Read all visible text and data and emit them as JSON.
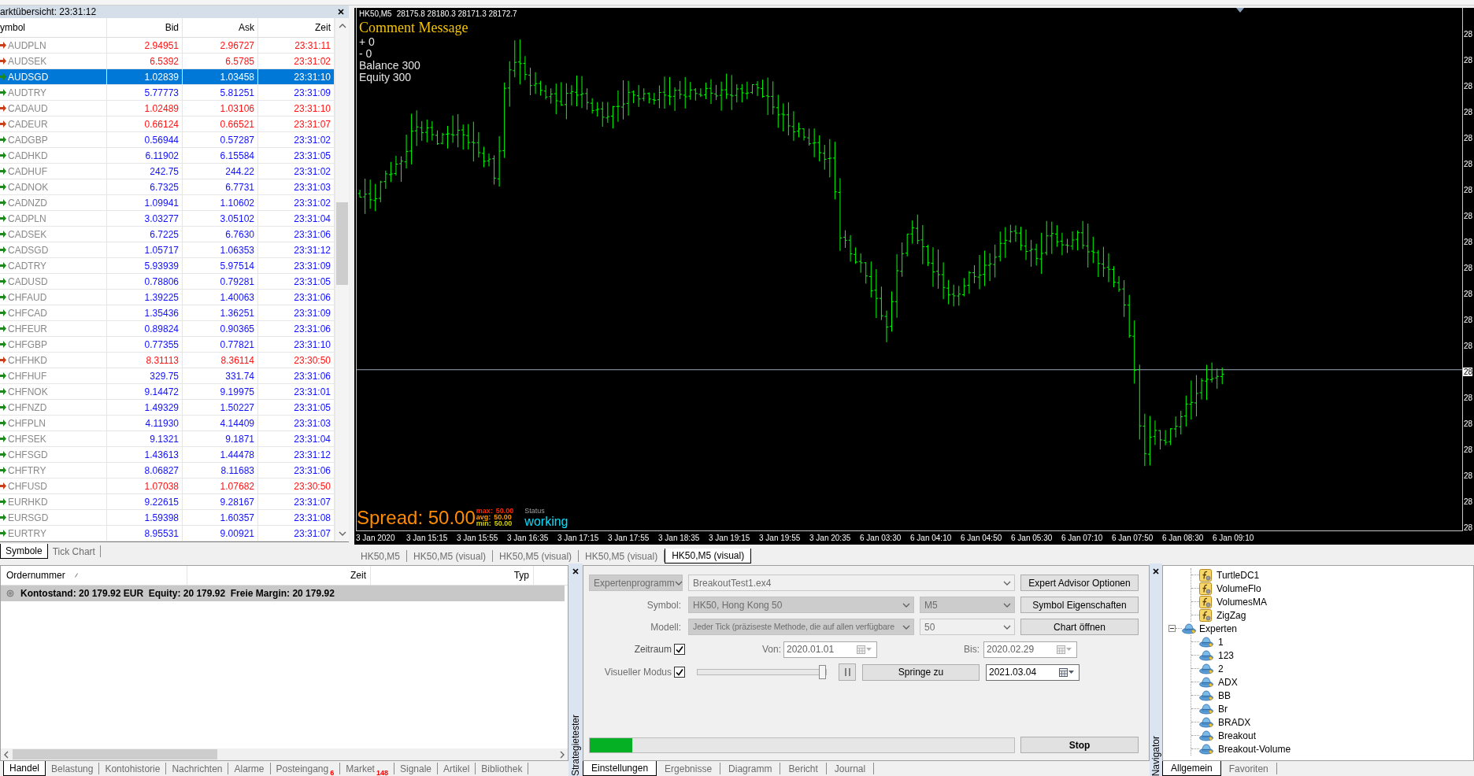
{
  "market_watch": {
    "title": "arktübersicht: 23:31:12",
    "columns": [
      "ymbol",
      "Bid",
      "Ask",
      "Zeit"
    ],
    "rows": [
      {
        "symbol": "AUDPLN",
        "bid": "2.94951",
        "ask": "2.96727",
        "time": "23:31:11",
        "rising": false,
        "selected": false
      },
      {
        "symbol": "AUDSEK",
        "bid": "6.5392",
        "ask": "6.5785",
        "time": "23:31:02",
        "rising": false,
        "selected": false
      },
      {
        "symbol": "AUDSGD",
        "bid": "1.02839",
        "ask": "1.03458",
        "time": "23:31:10",
        "rising": true,
        "selected": true
      },
      {
        "symbol": "AUDTRY",
        "bid": "5.77773",
        "ask": "5.81251",
        "time": "23:31:09",
        "rising": true,
        "selected": false
      },
      {
        "symbol": "CADAUD",
        "bid": "1.02489",
        "ask": "1.03106",
        "time": "23:31:10",
        "rising": false,
        "selected": false
      },
      {
        "symbol": "CADEUR",
        "bid": "0.66124",
        "ask": "0.66521",
        "time": "23:31:07",
        "rising": false,
        "selected": false
      },
      {
        "symbol": "CADGBP",
        "bid": "0.56944",
        "ask": "0.57287",
        "time": "23:31:02",
        "rising": true,
        "selected": false
      },
      {
        "symbol": "CADHKD",
        "bid": "6.11902",
        "ask": "6.15584",
        "time": "23:31:05",
        "rising": true,
        "selected": false
      },
      {
        "symbol": "CADHUF",
        "bid": "242.75",
        "ask": "244.22",
        "time": "23:31:02",
        "rising": true,
        "selected": false
      },
      {
        "symbol": "CADNOK",
        "bid": "6.7325",
        "ask": "6.7731",
        "time": "23:31:03",
        "rising": true,
        "selected": false
      },
      {
        "symbol": "CADNZD",
        "bid": "1.09941",
        "ask": "1.10602",
        "time": "23:31:02",
        "rising": true,
        "selected": false
      },
      {
        "symbol": "CADPLN",
        "bid": "3.03277",
        "ask": "3.05102",
        "time": "23:31:04",
        "rising": true,
        "selected": false
      },
      {
        "symbol": "CADSEK",
        "bid": "6.7225",
        "ask": "6.7630",
        "time": "23:31:06",
        "rising": true,
        "selected": false
      },
      {
        "symbol": "CADSGD",
        "bid": "1.05717",
        "ask": "1.06353",
        "time": "23:31:12",
        "rising": true,
        "selected": false
      },
      {
        "symbol": "CADTRY",
        "bid": "5.93939",
        "ask": "5.97514",
        "time": "23:31:09",
        "rising": true,
        "selected": false
      },
      {
        "symbol": "CADUSD",
        "bid": "0.78806",
        "ask": "0.79281",
        "time": "23:31:05",
        "rising": true,
        "selected": false
      },
      {
        "symbol": "CHFAUD",
        "bid": "1.39225",
        "ask": "1.40063",
        "time": "23:31:06",
        "rising": true,
        "selected": false
      },
      {
        "symbol": "CHFCAD",
        "bid": "1.35436",
        "ask": "1.36251",
        "time": "23:31:09",
        "rising": true,
        "selected": false
      },
      {
        "symbol": "CHFEUR",
        "bid": "0.89824",
        "ask": "0.90365",
        "time": "23:31:06",
        "rising": true,
        "selected": false
      },
      {
        "symbol": "CHFGBP",
        "bid": "0.77355",
        "ask": "0.77821",
        "time": "23:31:10",
        "rising": true,
        "selected": false
      },
      {
        "symbol": "CHFHKD",
        "bid": "8.31113",
        "ask": "8.36114",
        "time": "23:30:50",
        "rising": false,
        "selected": false
      },
      {
        "symbol": "CHFHUF",
        "bid": "329.75",
        "ask": "331.74",
        "time": "23:31:06",
        "rising": true,
        "selected": false
      },
      {
        "symbol": "CHFNOK",
        "bid": "9.14472",
        "ask": "9.19975",
        "time": "23:31:01",
        "rising": true,
        "selected": false
      },
      {
        "symbol": "CHFNZD",
        "bid": "1.49329",
        "ask": "1.50227",
        "time": "23:31:05",
        "rising": true,
        "selected": false
      },
      {
        "symbol": "CHFPLN",
        "bid": "4.11930",
        "ask": "4.14409",
        "time": "23:31:03",
        "rising": true,
        "selected": false
      },
      {
        "symbol": "CHFSEK",
        "bid": "9.1321",
        "ask": "9.1871",
        "time": "23:31:04",
        "rising": true,
        "selected": false
      },
      {
        "symbol": "CHFSGD",
        "bid": "1.43613",
        "ask": "1.44478",
        "time": "23:31:12",
        "rising": true,
        "selected": false
      },
      {
        "symbol": "CHFTRY",
        "bid": "8.06827",
        "ask": "8.11683",
        "time": "23:31:06",
        "rising": true,
        "selected": false
      },
      {
        "symbol": "CHFUSD",
        "bid": "1.07038",
        "ask": "1.07682",
        "time": "23:30:50",
        "rising": false,
        "selected": false
      },
      {
        "symbol": "EURHKD",
        "bid": "9.22615",
        "ask": "9.28167",
        "time": "23:31:07",
        "rising": true,
        "selected": false
      },
      {
        "symbol": "EURSGD",
        "bid": "1.59398",
        "ask": "1.60357",
        "time": "23:31:08",
        "rising": true,
        "selected": false
      },
      {
        "symbol": "EURTRY",
        "bid": "8.95531",
        "ask": "9.00921",
        "time": "23:31:07",
        "rising": true,
        "selected": false
      }
    ],
    "tabs": [
      {
        "label": "Symbole",
        "selected": true
      },
      {
        "label": "Tick Chart",
        "selected": false
      }
    ]
  },
  "chart": {
    "symbol": "HK50,M5",
    "ohlc": "28175.8 28180.3 28171.3 28172.7",
    "comment_title": "Comment Message",
    "comment_lines": [
      "+ 0",
      "- 0",
      "Balance 300",
      "Equity 300"
    ],
    "spread": "Spread: 50.00",
    "spread_stats": [
      {
        "label": "max:",
        "value": "50.00",
        "color": "#ff2a00"
      },
      {
        "label": "avg:",
        "value": "50.00",
        "color": "#ff9a00"
      },
      {
        "label": "min:",
        "value": "50.00",
        "color": "#d2d200"
      }
    ],
    "status_label": "Status",
    "status": "working",
    "time_labels": [
      "3 Jan 2020",
      "3 Jan 15:15",
      "3 Jan 15:55",
      "3 Jan 16:35",
      "3 Jan 17:15",
      "3 Jan 17:55",
      "3 Jan 18:35",
      "3 Jan 19:15",
      "3 Jan 19:55",
      "3 Jan 20:35",
      "6 Jan 03:30",
      "6 Jan 04:10",
      "6 Jan 04:50",
      "6 Jan 05:30",
      "6 Jan 07:10",
      "6 Jan 07:50",
      "6 Jan 08:30",
      "6 Jan 09:10"
    ],
    "price_labels": [
      {
        "text": "28",
        "current": false
      },
      {
        "text": "28",
        "current": false
      },
      {
        "text": "28",
        "current": false
      },
      {
        "text": "28",
        "current": false
      },
      {
        "text": "28",
        "current": false
      },
      {
        "text": "28",
        "current": false
      },
      {
        "text": "28",
        "current": false
      },
      {
        "text": "28",
        "current": false
      },
      {
        "text": "28",
        "current": false
      },
      {
        "text": "28",
        "current": false
      },
      {
        "text": "28",
        "current": false
      },
      {
        "text": "28",
        "current": false
      },
      {
        "text": "28",
        "current": false
      },
      {
        "text": "28",
        "current": true
      },
      {
        "text": "28",
        "current": false
      },
      {
        "text": "28",
        "current": false
      },
      {
        "text": "28",
        "current": false
      },
      {
        "text": "28",
        "current": false
      },
      {
        "text": "28",
        "current": false
      },
      {
        "text": "28",
        "current": false
      }
    ]
  },
  "chart_tabs": [
    {
      "label": "HK50,M5",
      "selected": false
    },
    {
      "label": "HK50,M5 (visual)",
      "selected": false
    },
    {
      "label": "HK50,M5 (visual)",
      "selected": false
    },
    {
      "label": "HK50,M5 (visual)",
      "selected": false
    },
    {
      "label": "HK50,M5 (visual)",
      "selected": true
    }
  ],
  "terminal": {
    "columns": [
      "Ordernummer",
      "Zeit",
      "Typ"
    ],
    "summary": "Kontostand: 20 179.92 EUR  Equity: 20 179.92  Freie Margin: 20 179.92",
    "tabs": [
      {
        "label": "Handel",
        "selected": true
      },
      {
        "label": "Belastung",
        "selected": false
      },
      {
        "label": "Kontohistorie",
        "selected": false
      },
      {
        "label": "Nachrichten",
        "selected": false
      },
      {
        "label": "Alarme",
        "selected": false
      },
      {
        "label": "Posteingang",
        "count": "6",
        "selected": false
      },
      {
        "label": "Market",
        "count": "148",
        "selected": false
      },
      {
        "label": "Signale",
        "selected": false
      },
      {
        "label": "Artikel",
        "selected": false
      },
      {
        "label": "Bibliothek",
        "selected": false
      }
    ]
  },
  "strategy_tester": {
    "side_title": "Strategietester",
    "expert_type": {
      "value": "Expertenprogramm",
      "kind": "dropdown",
      "disabled": true
    },
    "expert": {
      "value": "BreakoutTest1.ex4",
      "kind": "combo",
      "disabled": true
    },
    "expert_options_button": "Expert Advisor Optionen",
    "symbol_label": "Symbol:",
    "symbol": {
      "value": "HK50, Hong Kong 50",
      "kind": "dropdown",
      "disabled": true
    },
    "period": {
      "value": "M5",
      "kind": "dropdown",
      "disabled": true
    },
    "symbol_properties_button": "Symbol Eigenschaften",
    "model_label": "Modell:",
    "model": {
      "value": "Jeder Tick (präziseste Methode, die auf allen verfügbare",
      "kind": "dropdown",
      "disabled": true
    },
    "spread": {
      "value": "50",
      "kind": "combo",
      "disabled": true
    },
    "open_chart_button": "Chart öffnen",
    "date_range": {
      "label": "Zeitraum",
      "checked": true
    },
    "from": {
      "label": "Von:",
      "value": "2020.01.01",
      "disabled": true
    },
    "to": {
      "label": "Bis:",
      "value": "2020.02.29",
      "disabled": true
    },
    "visual_mode": {
      "label": "Visueller Modus",
      "checked": true
    },
    "speed": {
      "level": 1
    },
    "jump_button": "Springe zu",
    "jump_date": {
      "value": "2021.03.04",
      "disabled": false
    },
    "progress": {
      "level": 0.1
    },
    "stop_button": "Stop",
    "tabs": [
      {
        "label": "Einstellungen",
        "selected": true
      },
      {
        "label": "Ergebnisse",
        "selected": false
      },
      {
        "label": "Diagramm",
        "selected": false
      },
      {
        "label": "Bericht",
        "selected": false
      },
      {
        "label": "Journal",
        "selected": false
      }
    ]
  },
  "navigator": {
    "side_title": "Navigator",
    "tree": [
      {
        "children": [
          {
            "label": "TurtleDC1",
            "kind": "indicator"
          },
          {
            "label": "VolumeFlo",
            "kind": "indicator"
          },
          {
            "label": "VolumesMA",
            "kind": "indicator"
          },
          {
            "label": "ZigZag",
            "kind": "indicator"
          }
        ]
      },
      {
        "label": "Experten",
        "kind": "folder",
        "expanded": true,
        "children": [
          {
            "label": "1",
            "kind": "expert"
          },
          {
            "label": "123",
            "kind": "expert"
          },
          {
            "label": "2",
            "kind": "expert"
          },
          {
            "label": "ADX",
            "kind": "expert"
          },
          {
            "label": "BB",
            "kind": "expert"
          },
          {
            "label": "Br",
            "kind": "expert"
          },
          {
            "label": "BRADX",
            "kind": "expert"
          },
          {
            "label": "Breakout",
            "kind": "expert"
          },
          {
            "label": "Breakout-Volume",
            "kind": "expert"
          }
        ]
      }
    ],
    "tabs": [
      {
        "label": "Allgemein",
        "selected": true
      },
      {
        "label": "Favoriten",
        "selected": false
      }
    ]
  }
}
